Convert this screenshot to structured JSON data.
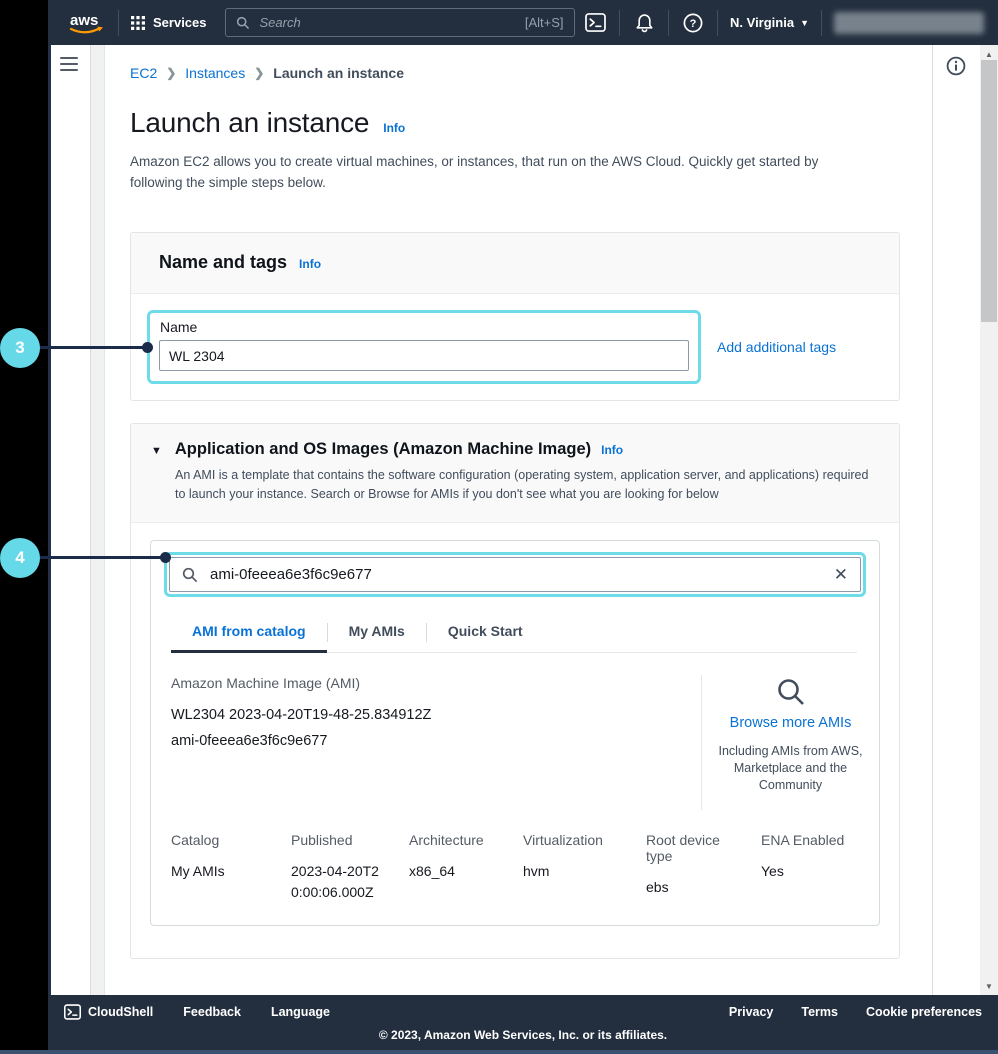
{
  "topbar": {
    "logo": "aws",
    "services_label": "Services",
    "search_placeholder": "Search",
    "search_shortcut": "[Alt+S]",
    "region": "N. Virginia"
  },
  "breadcrumb": {
    "items": [
      "EC2",
      "Instances",
      "Launch an instance"
    ]
  },
  "page": {
    "title": "Launch an instance",
    "info_label": "Info",
    "description": "Amazon EC2 allows you to create virtual machines, or instances, that run on the AWS Cloud. Quickly get started by following the simple steps below."
  },
  "name_and_tags": {
    "title": "Name and tags",
    "info_label": "Info",
    "name_label": "Name",
    "name_value": "WL 2304",
    "add_tags_label": "Add additional tags"
  },
  "ami_section": {
    "title": "Application and OS Images (Amazon Machine Image)",
    "info_label": "Info",
    "description": "An AMI is a template that contains the software configuration (operating system, application server, and applications) required to launch your instance. Search or Browse for AMIs if you don't see what you are looking for below",
    "search_value": "ami-0feeea6e3f6c9e677",
    "tabs": [
      {
        "label": "AMI from catalog",
        "active": true
      },
      {
        "label": "My AMIs",
        "active": false
      },
      {
        "label": "Quick Start",
        "active": false
      }
    ],
    "ami_label": "Amazon Machine Image (AMI)",
    "ami_name": "WL2304 2023-04-20T19-48-25.834912Z",
    "ami_id": "ami-0feeea6e3f6c9e677",
    "browse_label": "Browse more AMIs",
    "browse_note": "Including AMIs from AWS, Marketplace and the Community",
    "attributes": [
      {
        "label": "Catalog",
        "value": "My AMIs"
      },
      {
        "label": "Published",
        "value": "2023-04-20T20:00:06.000Z"
      },
      {
        "label": "Architecture",
        "value": "x86_64"
      },
      {
        "label": "Virtualization",
        "value": "hvm"
      },
      {
        "label": "Root device type",
        "value": "ebs"
      },
      {
        "label": "ENA Enabled",
        "value": "Yes"
      }
    ]
  },
  "annotations": [
    {
      "number": "3"
    },
    {
      "number": "4"
    }
  ],
  "footer": {
    "cloudshell_label": "CloudShell",
    "feedback_label": "Feedback",
    "language_label": "Language",
    "copyright": "© 2023, Amazon Web Services, Inc. or its affiliates.",
    "privacy_label": "Privacy",
    "terms_label": "Terms",
    "cookie_label": "Cookie preferences"
  },
  "icons": {
    "services_grid": "3x3-dot-grid",
    "search": "magnifier",
    "cloudshell": "terminal-prompt",
    "notifications": "bell",
    "help": "question-mark-circle",
    "region_caret": "caret-down",
    "menu": "hamburger",
    "info_panel": "circled-i",
    "clear": "x-mark",
    "section_collapse": "triangle-down",
    "scrollbar": "up-down-arrows"
  },
  "colors": {
    "nav_bg": "#232f3e",
    "link_blue": "#0972d3",
    "highlight_cyan": "#6edbe8",
    "annotation_line": "#1b2b4a",
    "aws_orange": "#ff9900"
  }
}
